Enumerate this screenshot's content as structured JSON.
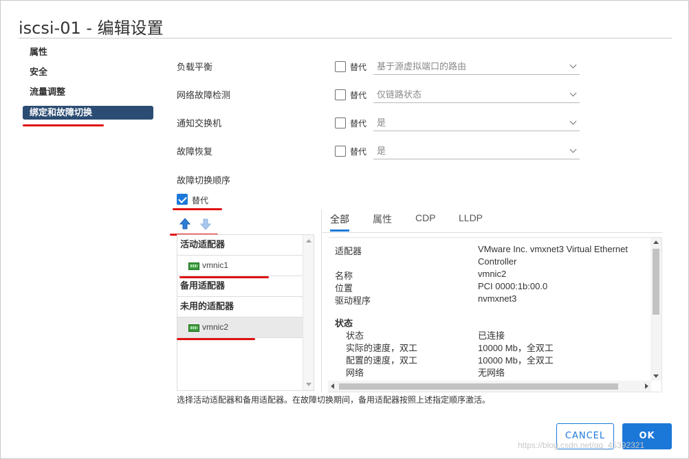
{
  "dialog": {
    "title": "iscsi-01 - 编辑设置"
  },
  "nav": {
    "items": [
      "属性",
      "安全",
      "流量调整",
      "绑定和故障切换"
    ]
  },
  "settings": [
    {
      "label": "负载平衡",
      "override_label": "替代",
      "value": "基于源虚拟端口的路由"
    },
    {
      "label": "网络故障检测",
      "override_label": "替代",
      "value": "仅链路状态"
    },
    {
      "label": "通知交换机",
      "override_label": "替代",
      "value": "是"
    },
    {
      "label": "故障恢复",
      "override_label": "替代",
      "value": "是"
    }
  ],
  "failover": {
    "title": "故障切换顺序",
    "override_label": "替代",
    "override_checked": true,
    "groups": {
      "active": "活动适配器",
      "standby": "备用适配器",
      "unused": "未用的适配器"
    },
    "adapters": {
      "active_1": "vmnic1",
      "unused_1": "vmnic2"
    },
    "hint": "选择活动适配器和备用适配器。在故障切换期间，备用适配器按照上述指定顺序激活。"
  },
  "tabs": [
    "全部",
    "属性",
    "CDP",
    "LLDP"
  ],
  "details": {
    "adapter_label": "适配器",
    "adapter_value_1": "VMware Inc. vmxnet3 Virtual Ethernet",
    "adapter_value_2": "Controller",
    "name_label": "名称",
    "name_value": "vmnic2",
    "location_label": "位置",
    "location_value": "PCI 0000:1b:00.0",
    "driver_label": "驱动程序",
    "driver_value": "nvmxnet3",
    "status_header": "状态",
    "state_label": "状态",
    "state_value": "已连接",
    "actual_speed_label": "实际的速度，双工",
    "actual_speed_value": "10000 Mb，全双工",
    "config_speed_label": "配置的速度，双工",
    "config_speed_value": "10000 Mb，全双工",
    "network_label": "网络",
    "network_value": "无网络"
  },
  "buttons": {
    "cancel": "CANCEL",
    "ok": "OK"
  },
  "watermark": "https://blog.csdn.net/qq_45392321",
  "colors": {
    "accent": "#1c78d8",
    "nav_active": "#2c4d73",
    "annotation": "#e01010"
  }
}
